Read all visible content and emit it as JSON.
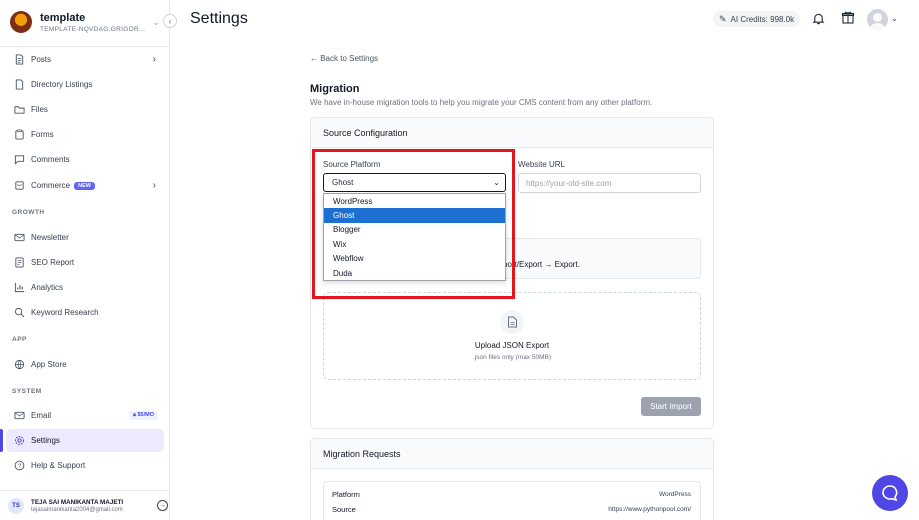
{
  "workspace": {
    "name": "template",
    "subtitle": "TEMPLATE-NQVDAG.GRIGOR..."
  },
  "nav": {
    "posts": "Posts",
    "directory": "Directory Listings",
    "files": "Files",
    "forms": "Forms",
    "comments": "Comments",
    "commerce": "Commerce",
    "commerce_badge": "NEW",
    "growth_label": "GROWTH",
    "newsletter": "Newsletter",
    "seo": "SEO Report",
    "analytics": "Analytics",
    "keyword": "Keyword Research",
    "app_label": "APP",
    "app_store": "App Store",
    "system_label": "SYSTEM",
    "email": "Email",
    "email_badge": "$5/MO",
    "settings": "Settings",
    "help": "Help & Support"
  },
  "user": {
    "initials": "TS",
    "name": "TEJA SAI MANIKANTA MAJETI",
    "email": "tejasaimanikanta2004@gmail.com"
  },
  "header": {
    "title": "Settings",
    "credits": "AI Credits: 998.0k"
  },
  "main": {
    "back": "← Back to Settings",
    "title": "Migration",
    "description": "We have in-house migration tools to help you migrate your CMS content from any other platform."
  },
  "source_config": {
    "title": "Source Configuration",
    "platform_label": "Source Platform",
    "platform_value": "Ghost",
    "platform_options": [
      "WordPress",
      "Ghost",
      "Blogger",
      "Wix",
      "Webflow",
      "Duda"
    ],
    "url_label": "Website URL",
    "url_placeholder": "https://your-old-site.com",
    "hint_visible": "port/Export → Export.",
    "upload_title": "Upload JSON Export",
    "upload_sub": ".json files only (max 50MB)",
    "start_button": "Start Import"
  },
  "requests": {
    "title": "Migration Requests",
    "platform_key": "Platform",
    "platform_val": "WordPress",
    "source_key": "Source",
    "source_val": "https://www.pythonpool.com/"
  },
  "colors": {
    "accent": "#4f46e5",
    "highlight": "#e3161e",
    "selected_option": "#1d6fd1"
  }
}
